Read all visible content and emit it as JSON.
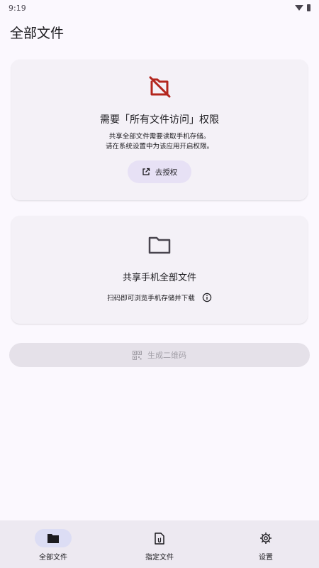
{
  "status_bar": {
    "time": "9:19"
  },
  "page_title": "全部文件",
  "permission_card": {
    "title": "需要「所有文件访问」权限",
    "desc_line1": "共享全部文件需要读取手机存储。",
    "desc_line2": "请在系统设置中为该应用开启权限。",
    "button_label": "去授权",
    "icon": "folder-off-icon",
    "icon_color": "#B3261E"
  },
  "share_card": {
    "title": "共享手机全部文件",
    "subtitle": "扫码即可浏览手机存储并下载",
    "icon": "folder-icon"
  },
  "qr_button": {
    "label": "生成二维码",
    "enabled": false
  },
  "bottom_nav": {
    "items": [
      {
        "label": "全部文件",
        "icon": "folder-icon",
        "active": true
      },
      {
        "label": "指定文件",
        "icon": "file-icon",
        "active": false
      },
      {
        "label": "设置",
        "icon": "gear-icon",
        "active": false
      }
    ]
  },
  "colors": {
    "background": "#FBF8FE",
    "card": "#F4F1F7",
    "accent_tonal": "#E7E1F5",
    "nav_indicator": "#DCDDF4",
    "error": "#B3261E"
  }
}
